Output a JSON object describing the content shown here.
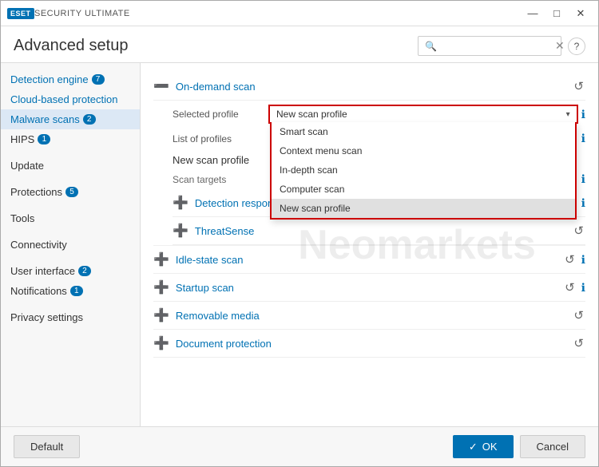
{
  "app": {
    "title": "SECURITY ULTIMATE",
    "window_title": "Advanced setup"
  },
  "titlebar": {
    "minimize_label": "—",
    "maximize_label": "□",
    "close_label": "✕"
  },
  "header": {
    "title": "Advanced setup",
    "search_placeholder": ""
  },
  "sidebar": {
    "items": [
      {
        "id": "detection-engine",
        "label": "Detection engine",
        "badge": "7",
        "active": false,
        "highlighted": false
      },
      {
        "id": "cloud-based-protection",
        "label": "Cloud-based protection",
        "badge": "",
        "active": false,
        "highlighted": true
      },
      {
        "id": "malware-scans",
        "label": "Malware scans",
        "badge": "2",
        "active": true,
        "highlighted": false
      },
      {
        "id": "hips",
        "label": "HIPS",
        "badge": "1",
        "active": false,
        "highlighted": false
      },
      {
        "id": "update",
        "label": "Update",
        "badge": "",
        "active": false,
        "highlighted": false
      },
      {
        "id": "protections",
        "label": "Protections",
        "badge": "5",
        "active": false,
        "highlighted": false
      },
      {
        "id": "tools",
        "label": "Tools",
        "badge": "",
        "active": false,
        "highlighted": false
      },
      {
        "id": "connectivity",
        "label": "Connectivity",
        "badge": "",
        "active": false,
        "highlighted": false
      },
      {
        "id": "user-interface",
        "label": "User interface",
        "badge": "2",
        "active": false,
        "highlighted": false
      },
      {
        "id": "notifications",
        "label": "Notifications",
        "badge": "1",
        "active": false,
        "highlighted": false
      },
      {
        "id": "privacy-settings",
        "label": "Privacy settings",
        "badge": "",
        "active": false,
        "highlighted": false
      }
    ]
  },
  "content": {
    "on_demand_scan": {
      "title": "On-demand scan",
      "selected_profile_label": "Selected profile",
      "selected_profile_value": "New scan profile",
      "list_of_profiles_label": "List of profiles",
      "new_scan_profile_label": "New scan profile",
      "scan_targets_label": "Scan targets",
      "detection_responses_label": "Detection responses for on-demand scan",
      "threatsense_label": "ThreatSense"
    },
    "dropdown": {
      "options": [
        {
          "label": "Smart scan",
          "selected": false
        },
        {
          "label": "Context menu scan",
          "selected": false
        },
        {
          "label": "In-depth scan",
          "selected": false
        },
        {
          "label": "Computer scan",
          "selected": false
        },
        {
          "label": "New scan profile",
          "selected": true
        }
      ]
    },
    "idle_state_scan": {
      "title": "Idle-state scan"
    },
    "startup_scan": {
      "title": "Startup scan"
    },
    "removable_media": {
      "title": "Removable media"
    },
    "document_protection": {
      "title": "Document protection"
    }
  },
  "footer": {
    "default_label": "Default",
    "ok_label": "OK",
    "ok_icon": "✓",
    "cancel_label": "Cancel"
  }
}
